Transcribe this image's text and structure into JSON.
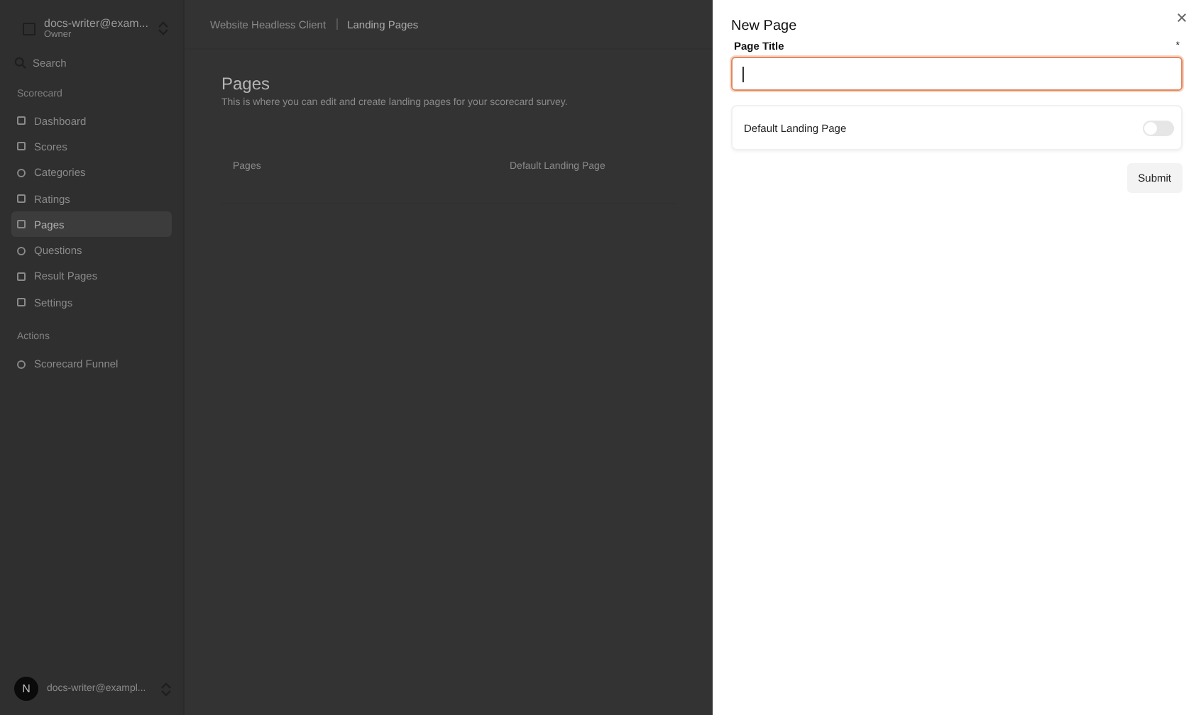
{
  "sidebar": {
    "account": {
      "name": "docs-writer@exam...",
      "role": "Owner"
    },
    "search": {
      "placeholder": "Search"
    },
    "groups": [
      {
        "label": "Scorecard",
        "items": [
          {
            "label": "Dashboard",
            "selected": false
          },
          {
            "label": "Scores",
            "selected": false
          },
          {
            "label": "Categories",
            "selected": false
          },
          {
            "label": "Ratings",
            "selected": false
          },
          {
            "label": "Pages",
            "selected": true
          },
          {
            "label": "Questions",
            "selected": false
          },
          {
            "label": "Result Pages",
            "selected": false
          },
          {
            "label": "Settings",
            "selected": false
          }
        ]
      },
      {
        "label": "Actions",
        "items": [
          {
            "label": "Scorecard Funnel",
            "selected": false
          }
        ]
      }
    ],
    "user": {
      "initial": "N",
      "email": "docs-writer@exampl..."
    }
  },
  "breadcrumb": [
    "Website Headless Client",
    "Landing Pages"
  ],
  "page": {
    "title": "Pages",
    "description": "This is where you can edit and create landing pages for your scorecard survey.",
    "columns": [
      "Pages",
      "Default Landing Page"
    ]
  },
  "panel": {
    "title": "New Page",
    "field": {
      "label": "Page Title",
      "required_mark": "*",
      "focused": true
    },
    "toggle": {
      "label": "Default Landing Page",
      "on": false
    },
    "submit": "Submit"
  }
}
